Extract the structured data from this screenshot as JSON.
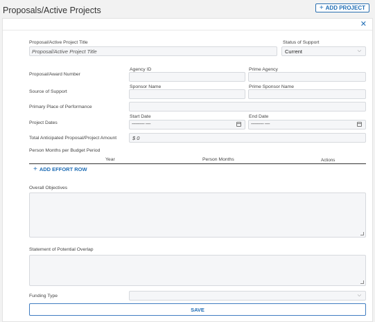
{
  "header": {
    "title": "Proposals/Active Projects",
    "add_project_label": "ADD PROJECT"
  },
  "form": {
    "title_label": "Proposal/Active Project Title",
    "title_placeholder": "Proposal/Active Project Title",
    "status_label": "Status of Support",
    "status_value": "Current",
    "award_number_label": "Proposal/Award Number",
    "agency_id_label": "Agency ID",
    "prime_agency_label": "Prime Agency",
    "source_support_label": "Source of Support",
    "sponsor_name_label": "Sponsor Name",
    "prime_sponsor_label": "Prime Sponsor Name",
    "primary_place_label": "Primary Place of Performance",
    "project_dates_label": "Project Dates",
    "start_date_label": "Start Date",
    "end_date_label": "End Date",
    "date_placeholder": "---------- ----",
    "total_amount_label": "Total Anticipated Proposal/Project Amount",
    "amount_value": "$ 0",
    "person_months_label": "Person Months per Budget Period",
    "col_year": "Year",
    "col_person_months": "Person Months",
    "col_actions": "Actions",
    "add_effort_label": "ADD EFFORT ROW",
    "objectives_label": "Overall Objectives",
    "overlap_label": "Statement of Potential Overlap",
    "funding_type_label": "Funding Type",
    "save_label": "SAVE"
  },
  "icons": {
    "close": "close-icon",
    "plus": "plus-icon",
    "caret": "chevron-down-icon",
    "calendar": "calendar-icon"
  },
  "colors": {
    "accent": "#1f6db5",
    "input_bg": "#f5f6f8",
    "page_bg": "#f2f2f2"
  }
}
